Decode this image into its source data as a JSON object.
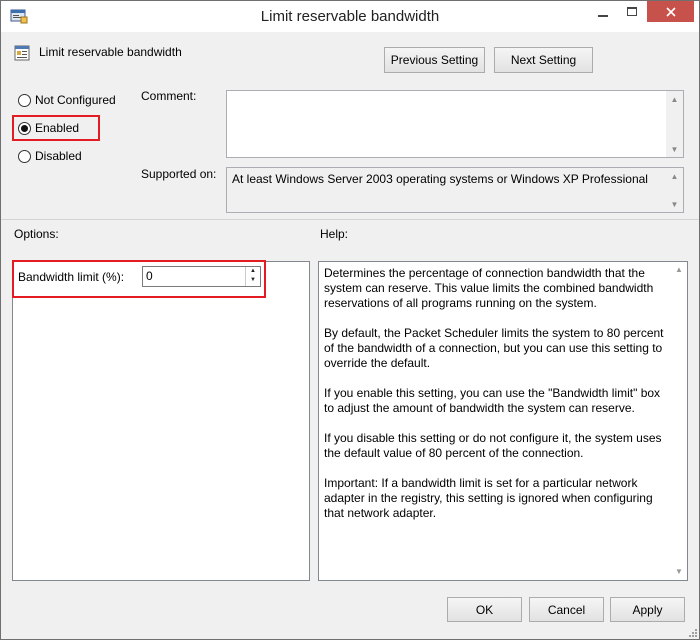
{
  "window": {
    "title": "Limit reservable bandwidth",
    "icons": {
      "app": "policy-editor-icon",
      "minimize": "minimize-icon",
      "maximize": "maximize-icon",
      "close": "close-icon"
    }
  },
  "header": {
    "policy_name": "Limit reservable bandwidth",
    "policy_icon": "policy-setting-icon",
    "previous_label": "Previous Setting",
    "next_label": "Next Setting"
  },
  "state": {
    "options": [
      {
        "label": "Not Configured",
        "selected": false
      },
      {
        "label": "Enabled",
        "selected": true
      },
      {
        "label": "Disabled",
        "selected": false
      }
    ]
  },
  "comment": {
    "label": "Comment:",
    "value": ""
  },
  "supported": {
    "label": "Supported on:",
    "value": "At least Windows Server 2003 operating systems or Windows XP Professional"
  },
  "options_section": {
    "label": "Options:",
    "bandwidth_label": "Bandwidth limit (%):",
    "bandwidth_value": "0"
  },
  "help_section": {
    "label": "Help:",
    "paragraphs": [
      "Determines the percentage of connection bandwidth that the system can reserve. This value limits the combined bandwidth reservations of all programs running on the system.",
      "By default, the Packet Scheduler limits the system to 80 percent of the bandwidth of a connection, but you can use this setting to override the default.",
      "If you enable this setting, you can use the \"Bandwidth limit\" box to adjust the amount of bandwidth the system can reserve.",
      "If you disable this setting or do not configure it, the system uses the default value of 80 percent of the connection.",
      "Important: If a bandwidth limit is set for a particular network adapter in the registry, this setting is ignored when configuring that network adapter."
    ]
  },
  "footer": {
    "ok_label": "OK",
    "cancel_label": "Cancel",
    "apply_label": "Apply"
  },
  "colors": {
    "highlight": "#e31b23",
    "close_button": "#c7514b",
    "dialog_bg": "#f0f0f0"
  }
}
